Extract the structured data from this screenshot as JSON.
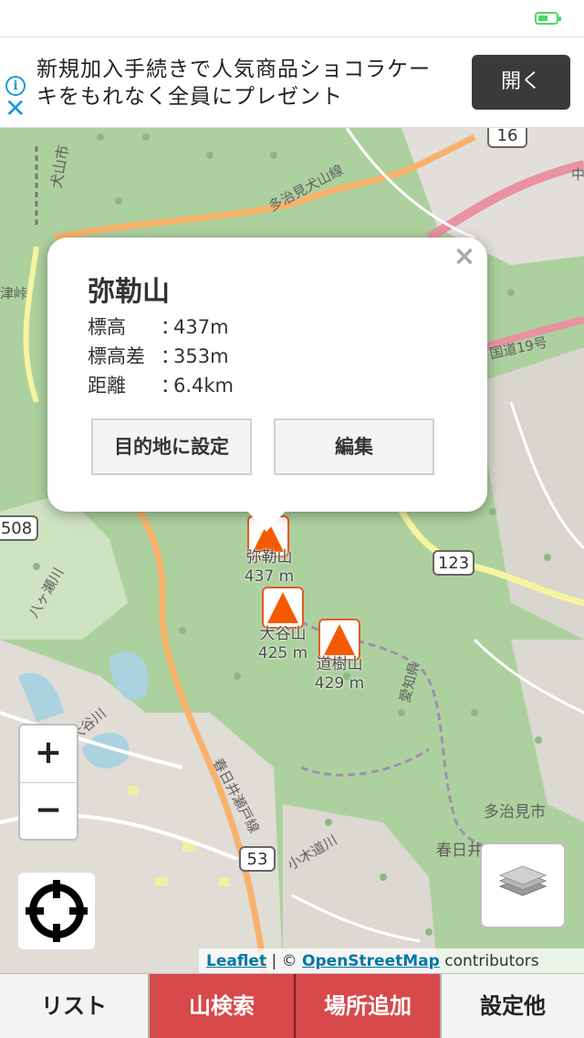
{
  "ad": {
    "text": "新規加入手続きで人気商品ショコラケーキをもれなく全員にプレゼント",
    "open_button": "開く",
    "info_icon": "info-icon",
    "close_icon": "close-icon"
  },
  "map": {
    "labels": {
      "city_inuyama": "犬山市",
      "road_tajimi_inuyama": "多治見犬山線",
      "route_16": "16",
      "route_508": "508",
      "route_123": "123",
      "route_53": "53",
      "national_19": "国道19号",
      "river_yagasawa": "八ヶ瀬川",
      "river_daisa": "大谷川",
      "road_kasugai_seto": "春日井瀬戸線",
      "river_kogiri": "小木道川",
      "city_tajimi": "多治見市",
      "city_kasugai": "春日井市",
      "aichi": "愛知県",
      "tsugawa": "津峠",
      "chu": "中"
    },
    "peaks": [
      {
        "name": "弥勒山",
        "elevation": "437 m"
      },
      {
        "name": "大谷山",
        "elevation": "425 m"
      },
      {
        "name": "道樹山",
        "elevation": "429 m"
      }
    ],
    "attribution": {
      "leaflet": "Leaflet",
      "sep": " | © ",
      "osm": "OpenStreetMap",
      "suffix": " contributors"
    }
  },
  "popup": {
    "title": "弥勒山",
    "rows": [
      {
        "label": "標高",
        "sep": "：",
        "value": "437m"
      },
      {
        "label": "標高差",
        "sep": "：",
        "value": "353m"
      },
      {
        "label": "距離",
        "sep": "：",
        "value": "6.4km"
      }
    ],
    "set_destination": "目的地に設定",
    "edit": "編集",
    "close": "×"
  },
  "controls": {
    "zoom_in": "+",
    "zoom_out": "−"
  },
  "tabs": {
    "list": "リスト",
    "mountain_search": "山検索",
    "add_place": "場所追加",
    "settings": "設定他"
  },
  "colors": {
    "tab_active": "#d7494b",
    "marker": "#f55a00",
    "ad_button": "#3a3a3a"
  }
}
